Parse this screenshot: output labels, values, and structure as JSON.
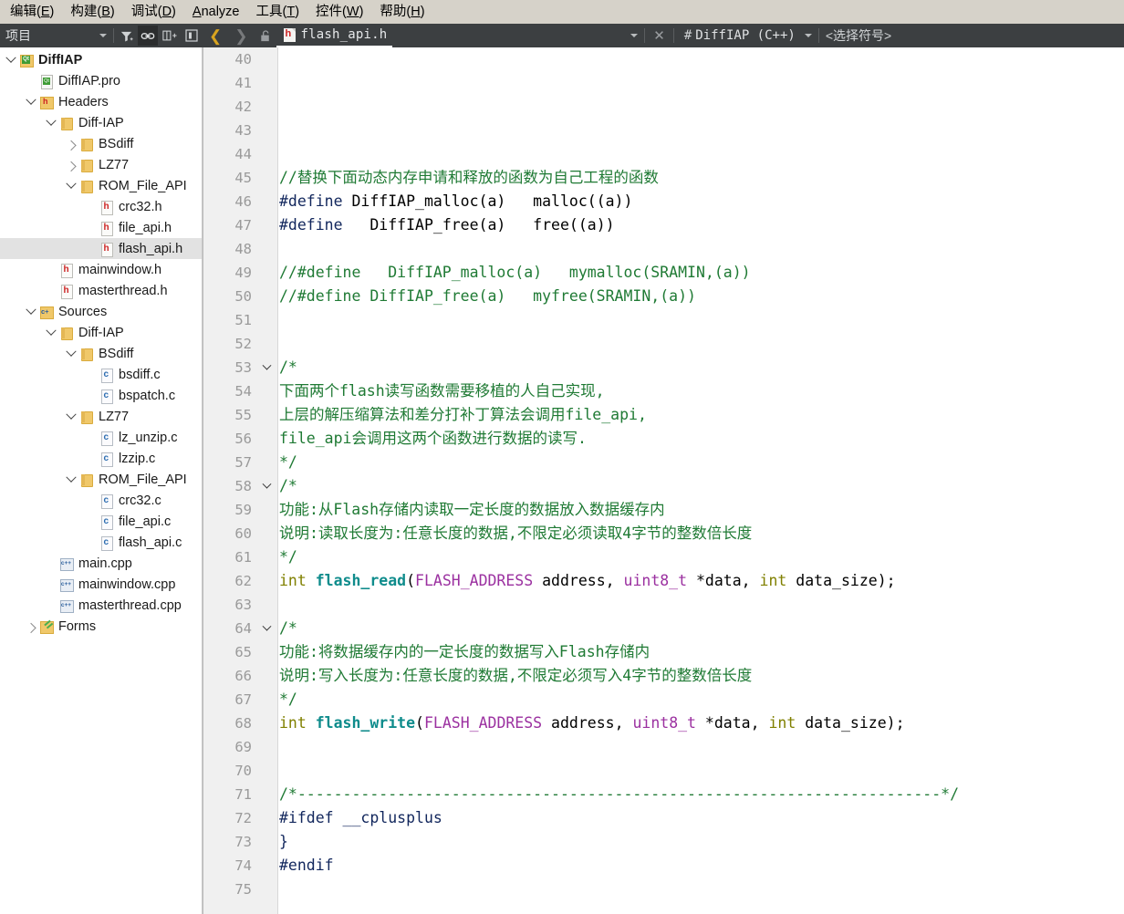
{
  "menubar": {
    "items": [
      {
        "label": "编辑",
        "mnemonic": "E"
      },
      {
        "label": "构建",
        "mnemonic": "B"
      },
      {
        "label": "调试",
        "mnemonic": "D"
      },
      {
        "label": "Analyze",
        "mnemonic": "A",
        "inline": true
      },
      {
        "label": "工具",
        "mnemonic": "T"
      },
      {
        "label": "控件",
        "mnemonic": "W"
      },
      {
        "label": "帮助",
        "mnemonic": "H"
      }
    ]
  },
  "toolbar": {
    "project_combo": "项目",
    "icons": {
      "filter": "filter-icon",
      "link": "link-icon",
      "split": "split-view-icon",
      "sidebar": "toggle-sidebar-icon",
      "back": "nav-back-icon",
      "forward": "nav-forward-icon",
      "lock": "unlock-icon"
    },
    "tab": {
      "filename": "flash_api.h",
      "icon": "h-file-icon",
      "close": "✕",
      "dropdown": "▾"
    },
    "scope": {
      "hash": "#",
      "label": "DiffIAP  (C++)",
      "dropdown": "▾"
    },
    "symbol_placeholder": "<选择符号>"
  },
  "sidebar": {
    "tree": [
      {
        "label": "DiffIAP",
        "indent": 0,
        "twisty": "open",
        "icon": "qtproj",
        "bold": true,
        "selected": false
      },
      {
        "label": "DiffIAP.pro",
        "indent": 1,
        "twisty": "none",
        "icon": "pro",
        "bold": false,
        "selected": false
      },
      {
        "label": "Headers",
        "indent": 1,
        "twisty": "open",
        "icon": "hgroup",
        "bold": false,
        "selected": false
      },
      {
        "label": "Diff-IAP",
        "indent": 2,
        "twisty": "open",
        "icon": "folder",
        "bold": false,
        "selected": false
      },
      {
        "label": "BSdiff",
        "indent": 3,
        "twisty": "closed",
        "icon": "folder",
        "bold": false,
        "selected": false
      },
      {
        "label": "LZ77",
        "indent": 3,
        "twisty": "closed",
        "icon": "folder",
        "bold": false,
        "selected": false
      },
      {
        "label": "ROM_File_API",
        "indent": 3,
        "twisty": "open",
        "icon": "folder",
        "bold": false,
        "selected": false
      },
      {
        "label": "crc32.h",
        "indent": 4,
        "twisty": "none",
        "icon": "h",
        "bold": false,
        "selected": false
      },
      {
        "label": "file_api.h",
        "indent": 4,
        "twisty": "none",
        "icon": "h",
        "bold": false,
        "selected": false
      },
      {
        "label": "flash_api.h",
        "indent": 4,
        "twisty": "none",
        "icon": "h",
        "bold": false,
        "selected": true
      },
      {
        "label": "mainwindow.h",
        "indent": 2,
        "twisty": "none",
        "icon": "h",
        "bold": false,
        "selected": false
      },
      {
        "label": "masterthread.h",
        "indent": 2,
        "twisty": "none",
        "icon": "h",
        "bold": false,
        "selected": false
      },
      {
        "label": "Sources",
        "indent": 1,
        "twisty": "open",
        "icon": "cgroup",
        "bold": false,
        "selected": false
      },
      {
        "label": "Diff-IAP",
        "indent": 2,
        "twisty": "open",
        "icon": "folder",
        "bold": false,
        "selected": false
      },
      {
        "label": "BSdiff",
        "indent": 3,
        "twisty": "open",
        "icon": "folder",
        "bold": false,
        "selected": false
      },
      {
        "label": "bsdiff.c",
        "indent": 4,
        "twisty": "none",
        "icon": "c",
        "bold": false,
        "selected": false
      },
      {
        "label": "bspatch.c",
        "indent": 4,
        "twisty": "none",
        "icon": "c",
        "bold": false,
        "selected": false
      },
      {
        "label": "LZ77",
        "indent": 3,
        "twisty": "open",
        "icon": "folder",
        "bold": false,
        "selected": false
      },
      {
        "label": "lz_unzip.c",
        "indent": 4,
        "twisty": "none",
        "icon": "c",
        "bold": false,
        "selected": false
      },
      {
        "label": "lzzip.c",
        "indent": 4,
        "twisty": "none",
        "icon": "c",
        "bold": false,
        "selected": false
      },
      {
        "label": "ROM_File_API",
        "indent": 3,
        "twisty": "open",
        "icon": "folder",
        "bold": false,
        "selected": false
      },
      {
        "label": "crc32.c",
        "indent": 4,
        "twisty": "none",
        "icon": "c",
        "bold": false,
        "selected": false
      },
      {
        "label": "file_api.c",
        "indent": 4,
        "twisty": "none",
        "icon": "c",
        "bold": false,
        "selected": false
      },
      {
        "label": "flash_api.c",
        "indent": 4,
        "twisty": "none",
        "icon": "c",
        "bold": false,
        "selected": false
      },
      {
        "label": "main.cpp",
        "indent": 2,
        "twisty": "none",
        "icon": "cpp",
        "bold": false,
        "selected": false
      },
      {
        "label": "mainwindow.cpp",
        "indent": 2,
        "twisty": "none",
        "icon": "cpp",
        "bold": false,
        "selected": false
      },
      {
        "label": "masterthread.cpp",
        "indent": 2,
        "twisty": "none",
        "icon": "cpp",
        "bold": false,
        "selected": false
      },
      {
        "label": "Forms",
        "indent": 1,
        "twisty": "closed",
        "icon": "forms",
        "bold": false,
        "selected": false
      }
    ]
  },
  "editor": {
    "first_line": 40,
    "colors": {
      "comment": "#1f7a34",
      "keyword": "#808000",
      "function": "#0f8c8c",
      "type": "#9b30a0",
      "preprocessor": "#11265c",
      "plain": "#000000",
      "gutter_bg": "#f0f0f0",
      "line_number": "#9a9a9a",
      "background": "#ffffff"
    },
    "lines": [
      {
        "n": 40,
        "fold": false,
        "tokens": []
      },
      {
        "n": 41,
        "fold": false,
        "tokens": []
      },
      {
        "n": 42,
        "fold": false,
        "tokens": []
      },
      {
        "n": 43,
        "fold": false,
        "tokens": []
      },
      {
        "n": 44,
        "fold": false,
        "tokens": []
      },
      {
        "n": 45,
        "fold": false,
        "tokens": [
          [
            "cm",
            "//替换下面动态内存申请和释放的函数为自己工程的函数"
          ]
        ]
      },
      {
        "n": 46,
        "fold": false,
        "tokens": [
          [
            "pp",
            "#define"
          ],
          [
            "pl",
            " DiffIAP_malloc(a)   malloc((a))"
          ]
        ]
      },
      {
        "n": 47,
        "fold": false,
        "tokens": [
          [
            "pp",
            "#define"
          ],
          [
            "pl",
            "   DiffIAP_free(a)   free((a))"
          ]
        ]
      },
      {
        "n": 48,
        "fold": false,
        "tokens": []
      },
      {
        "n": 49,
        "fold": false,
        "tokens": [
          [
            "cm",
            "//#define   DiffIAP_malloc(a)   mymalloc(SRAMIN,(a))"
          ]
        ]
      },
      {
        "n": 50,
        "fold": false,
        "tokens": [
          [
            "cm",
            "//#define DiffIAP_free(a)   myfree(SRAMIN,(a))"
          ]
        ]
      },
      {
        "n": 51,
        "fold": false,
        "tokens": []
      },
      {
        "n": 52,
        "fold": false,
        "tokens": []
      },
      {
        "n": 53,
        "fold": true,
        "tokens": [
          [
            "cm",
            "/*"
          ]
        ]
      },
      {
        "n": 54,
        "fold": false,
        "tokens": [
          [
            "cm",
            "下面两个flash读写函数需要移植的人自己实现,"
          ]
        ]
      },
      {
        "n": 55,
        "fold": false,
        "tokens": [
          [
            "cm",
            "上层的解压缩算法和差分打补丁算法会调用file_api,"
          ]
        ]
      },
      {
        "n": 56,
        "fold": false,
        "tokens": [
          [
            "cm",
            "file_api会调用这两个函数进行数据的读写."
          ]
        ]
      },
      {
        "n": 57,
        "fold": false,
        "tokens": [
          [
            "cm",
            "*/"
          ]
        ]
      },
      {
        "n": 58,
        "fold": true,
        "tokens": [
          [
            "cm",
            "/*"
          ]
        ]
      },
      {
        "n": 59,
        "fold": false,
        "tokens": [
          [
            "cm",
            "功能:从Flash存储内读取一定长度的数据放入数据缓存内"
          ]
        ]
      },
      {
        "n": 60,
        "fold": false,
        "tokens": [
          [
            "cm",
            "说明:读取长度为:任意长度的数据,不限定必须读取4字节的整数倍长度"
          ]
        ]
      },
      {
        "n": 61,
        "fold": false,
        "tokens": [
          [
            "cm",
            "*/"
          ]
        ]
      },
      {
        "n": 62,
        "fold": false,
        "tokens": [
          [
            "kw",
            "int"
          ],
          [
            "pl",
            " "
          ],
          [
            "fn",
            "flash_read"
          ],
          [
            "pl",
            "("
          ],
          [
            "ty",
            "FLASH_ADDRESS"
          ],
          [
            "pl",
            " address, "
          ],
          [
            "ty",
            "uint8_t"
          ],
          [
            "pl",
            " *data, "
          ],
          [
            "kw",
            "int"
          ],
          [
            "pl",
            " data_size);"
          ]
        ]
      },
      {
        "n": 63,
        "fold": false,
        "tokens": []
      },
      {
        "n": 64,
        "fold": true,
        "tokens": [
          [
            "cm",
            "/*"
          ]
        ]
      },
      {
        "n": 65,
        "fold": false,
        "tokens": [
          [
            "cm",
            "功能:将数据缓存内的一定长度的数据写入Flash存储内"
          ]
        ]
      },
      {
        "n": 66,
        "fold": false,
        "tokens": [
          [
            "cm",
            "说明:写入长度为:任意长度的数据,不限定必须写入4字节的整数倍长度"
          ]
        ]
      },
      {
        "n": 67,
        "fold": false,
        "tokens": [
          [
            "cm",
            "*/"
          ]
        ]
      },
      {
        "n": 68,
        "fold": false,
        "tokens": [
          [
            "kw",
            "int"
          ],
          [
            "pl",
            " "
          ],
          [
            "fn",
            "flash_write"
          ],
          [
            "pl",
            "("
          ],
          [
            "ty",
            "FLASH_ADDRESS"
          ],
          [
            "pl",
            " address, "
          ],
          [
            "ty",
            "uint8_t"
          ],
          [
            "pl",
            " *data, "
          ],
          [
            "kw",
            "int"
          ],
          [
            "pl",
            " data_size);"
          ]
        ]
      },
      {
        "n": 69,
        "fold": false,
        "tokens": []
      },
      {
        "n": 70,
        "fold": false,
        "tokens": []
      },
      {
        "n": 71,
        "fold": false,
        "tokens": [
          [
            "cm",
            "/*-----------------------------------------------------------------------*/"
          ]
        ]
      },
      {
        "n": 72,
        "fold": false,
        "tokens": [
          [
            "pp",
            "#ifdef __cplusplus"
          ]
        ]
      },
      {
        "n": 73,
        "fold": false,
        "tokens": [
          [
            "pp",
            "}"
          ]
        ]
      },
      {
        "n": 74,
        "fold": false,
        "tokens": [
          [
            "pp",
            "#endif"
          ]
        ]
      },
      {
        "n": 75,
        "fold": false,
        "tokens": []
      }
    ]
  }
}
